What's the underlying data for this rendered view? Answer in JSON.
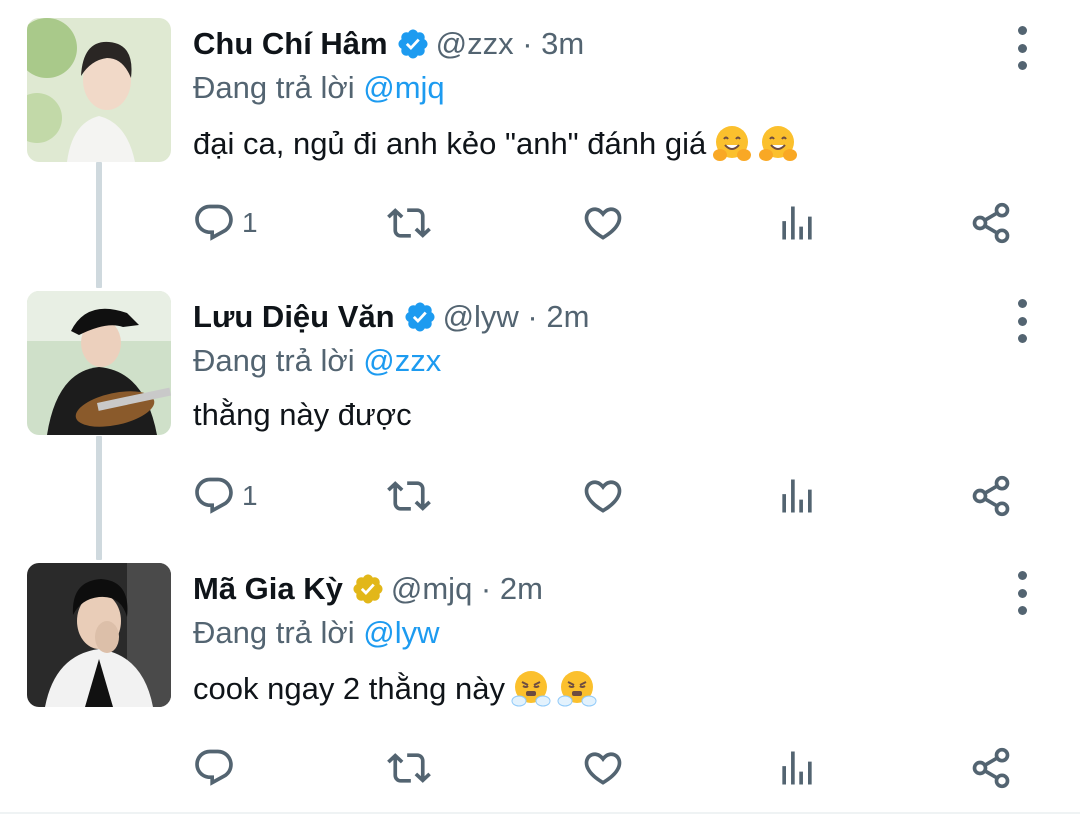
{
  "replying_prefix": "Đang trả lời",
  "tweets": [
    {
      "name": "Chu Chí Hâm",
      "verified": "blue",
      "handle": "@zzx · 3m",
      "reply_to": "@mjq",
      "text": "đại ca, ngủ đi anh kẻo \"anh\" đánh giá",
      "emojis": [
        "hugging-face",
        "hugging-face"
      ],
      "reply_count": "1"
    },
    {
      "name": "Lưu Diệu Văn",
      "verified": "blue",
      "handle": "@lyw · 2m",
      "reply_to": "@zzx",
      "text": "thằng này được",
      "emojis": [],
      "reply_count": "1"
    },
    {
      "name": "Mã Gia Kỳ",
      "verified": "gold",
      "handle": "@mjq · 2m",
      "reply_to": "@lyw",
      "text": "cook ngay 2 thằng này",
      "emojis": [
        "steam-from-nose",
        "steam-from-nose"
      ],
      "reply_count": ""
    }
  ],
  "colors": {
    "accent": "#1d9bf0",
    "verified_blue": "#1d9bf0",
    "verified_gold": "#e2b719",
    "secondary_text": "#536471",
    "thread_line": "#cfd9de"
  },
  "icons": [
    "reply-icon",
    "retweet-icon",
    "like-icon",
    "views-icon",
    "share-icon",
    "more-icon",
    "verified-badge-icon"
  ]
}
